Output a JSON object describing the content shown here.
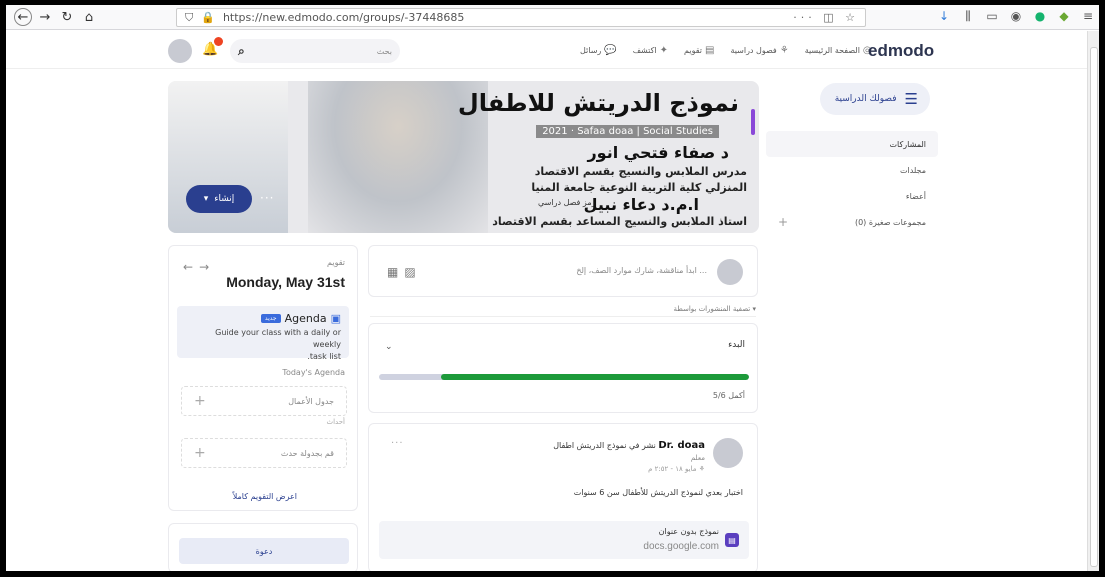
{
  "browser": {
    "url": "https://new.edmodo.com/groups/-37448685",
    "more": "···"
  },
  "header": {
    "logo": "edmodo",
    "nav": [
      "الصفحة الرئيسية",
      "فصول دراسية",
      "تقويم",
      "اكتشف",
      "رسائل"
    ],
    "search_placeholder": "بحث"
  },
  "banner": {
    "title": "نموذج الدريتش للاطفال",
    "subtitle": "Safaa doaa | Social Studies",
    "year": "2021",
    "line1": "د صفاء فتحي انور",
    "line2": "مدرس الملابس والنسيج بقسم الاقتصاد",
    "line3": "المنزلي كلية التربية النوعية جامعة المنيا",
    "line4": "ا.م.د دعاء نبيل",
    "line5": "استاذ الملابس والنسيج المساعد بقسم الاقتصاد",
    "code_label": "رمز فصل دراسي",
    "create_label": "إنشاء",
    "more": "···"
  },
  "sidebar": {
    "classes_label": "فصولك الدراسية",
    "items": [
      "المشاركات",
      "مجلدات",
      "أعضاء",
      "مجموعات صغيرة (0)"
    ]
  },
  "calendar": {
    "label": "تقويم",
    "date": "Monday, May 31st",
    "agenda_title": "Agenda",
    "agenda_new": "جديد",
    "agenda_desc1": "Guide your class with a daily or weekly",
    "agenda_desc2": ".task list",
    "todays_agenda": "Today's Agenda",
    "agenda_table": "جدول الأعمال",
    "events_label": "أحداث",
    "schedule_event": "قم بجدولة حدث",
    "view_full": "اعرض التقويم كاملاً"
  },
  "invite": {
    "label": "دعوة"
  },
  "composer": {
    "placeholder": "ابدأ مناقشة، شارك موارد الصف، إلخ ..."
  },
  "filter": {
    "label": "تصفية المنشورات بواسطة ▾"
  },
  "progress": {
    "label": "البدء",
    "count": "أكمل 5/6",
    "fraction": 0.833
  },
  "post": {
    "author": "Dr. doaa",
    "action": "نشر في نموذج الدريتش اطفال",
    "role": "معلم",
    "time": "مايو ١٨ - ٢:٥٢ م",
    "text": "اختبار بعدي لنموذج الدريتش للأطفال سن 6 سنوات",
    "attachment_title": "نموذج بدون عنوان",
    "attachment_source": "docs.google.com",
    "more": "···"
  },
  "colors": {
    "brand": "#2a3f8f",
    "progress": "#1d9a3a",
    "notification": "#ee4422"
  }
}
